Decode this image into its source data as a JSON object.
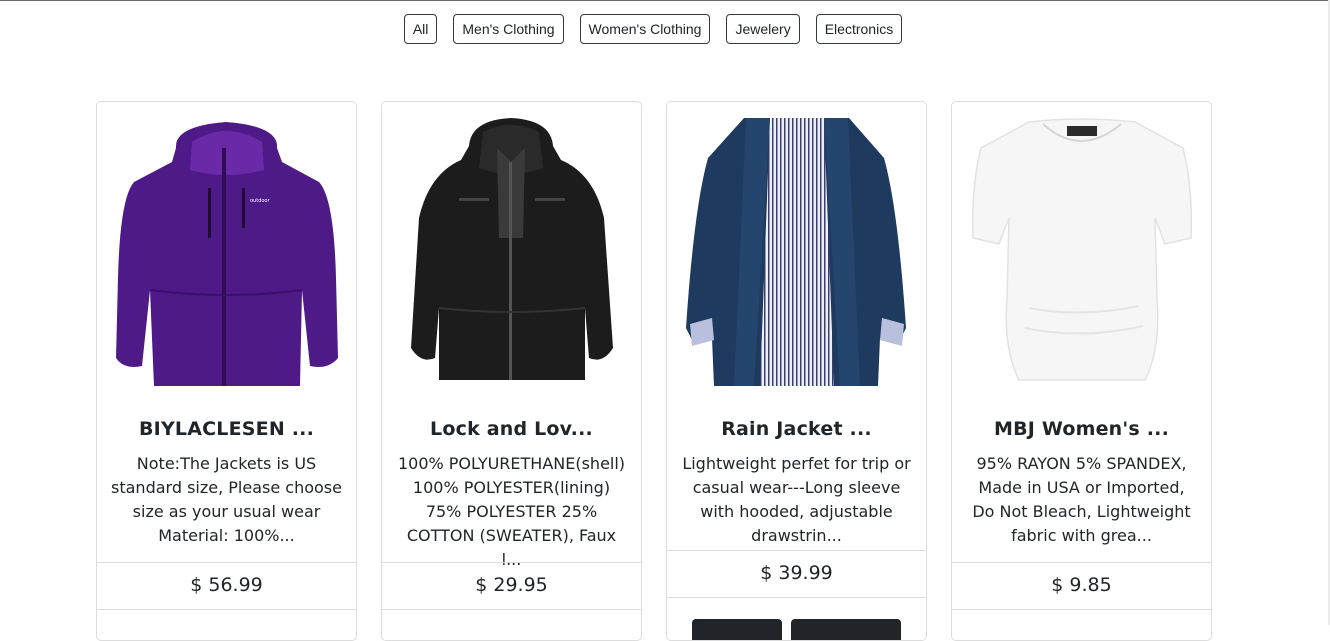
{
  "filters": [
    "All",
    "Men's Clothing",
    "Women's Clothing",
    "Jewelery",
    "Electronics"
  ],
  "products": [
    {
      "title": "BIYLACLESEN ...",
      "description": "Note:The Jackets is US standard size, Please choose size as your usual wear Material: 100%...",
      "price": "$ 56.99"
    },
    {
      "title": "Lock and Lov...",
      "description": "100% POLYURETHANE(shell) 100% POLYESTER(lining) 75% POLYESTER 25% COTTON (SWEATER), Faux l...",
      "price": "$ 29.95"
    },
    {
      "title": "Rain Jacket ...",
      "description": "Lightweight perfet for trip or casual wear---Long sleeve with hooded, adjustable drawstrin...",
      "price": "$ 39.99"
    },
    {
      "title": "MBJ Women's ...",
      "description": "95% RAYON 5% SPANDEX, Made in USA or Imported, Do Not Bleach, Lightweight fabric with grea...",
      "price": "$ 9.85"
    }
  ]
}
